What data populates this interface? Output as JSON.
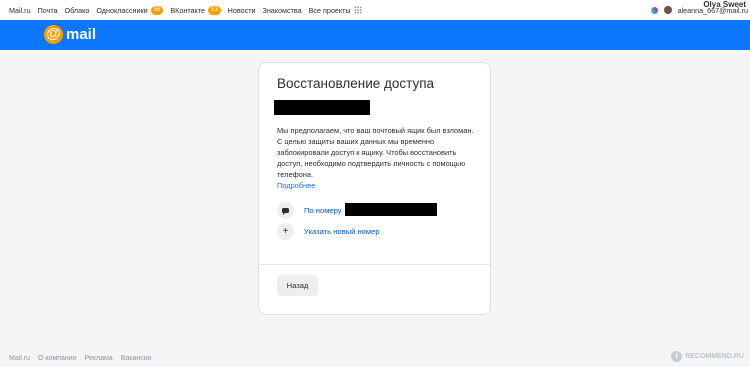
{
  "topbar": {
    "links": [
      {
        "label": "Mail.ru"
      },
      {
        "label": "Почта"
      },
      {
        "label": "Облако"
      },
      {
        "label": "Одноклассники",
        "badge": "56"
      },
      {
        "label": "ВКонтакте",
        "badge": "83"
      },
      {
        "label": "Новости"
      },
      {
        "label": "Знакомства"
      },
      {
        "label": "Все проекты"
      }
    ],
    "user_email": "aleanna_667@mail.ru",
    "overlay_name": "Olya Sweet"
  },
  "header": {
    "logo_symbol": "@",
    "logo_text": "mail",
    "color": "#0d77ff"
  },
  "card": {
    "title": "Восстановление доступа",
    "description": "Мы предполагаем, что ваш почтовый ящик был взломан. С целью защиты ваших данных мы временно заблокировали доступ к ящику. Чтобы восстановить доступ, необходимо подтвердить личность с помощью телефона.",
    "more_link": "Подробнее",
    "options": [
      {
        "label": "По номеру",
        "icon": "chat-icon"
      },
      {
        "label": "Указать новый номер",
        "icon": "plus-icon"
      }
    ],
    "back_label": "Назад"
  },
  "footer": {
    "links": [
      "Mail.ru",
      "О компании",
      "Реклама",
      "Вакансии"
    ]
  },
  "watermark": {
    "text": "RECOMMEND.RU",
    "symbol": "i"
  }
}
